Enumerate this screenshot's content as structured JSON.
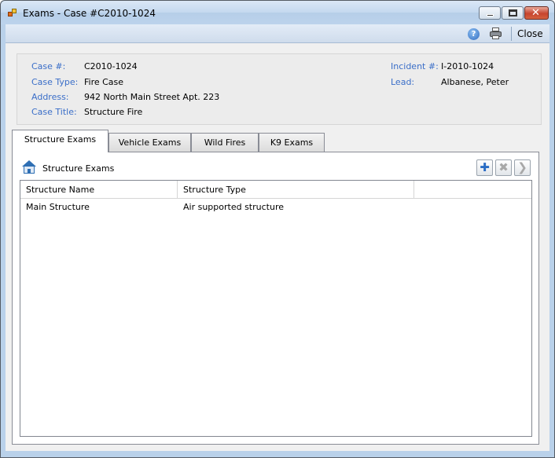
{
  "window": {
    "title": "Exams - Case #C2010-1024",
    "close_label": "Close",
    "colors": {
      "title_bar": "#c4d9ef",
      "label_blue": "#3a6ec8",
      "window_frame": "#b9d1ea"
    }
  },
  "case_info": {
    "case_number_label": "Case #:",
    "case_number": "C2010-1024",
    "case_type_label": "Case Type:",
    "case_type": "Fire Case",
    "address_label": "Address:",
    "address": "942 North Main Street Apt. 223",
    "case_title_label": "Case Title:",
    "case_title": "Structure Fire",
    "incident_label": "Incident #:",
    "incident": "I-2010-1024",
    "lead_label": "Lead:",
    "lead": "Albanese, Peter"
  },
  "tabs": [
    {
      "label": "Structure Exams",
      "active": true
    },
    {
      "label": "Vehicle Exams",
      "active": false
    },
    {
      "label": "Wild Fires",
      "active": false
    },
    {
      "label": "K9 Exams",
      "active": false
    }
  ],
  "section": {
    "title": "Structure Exams",
    "icon": "house-icon",
    "actions": [
      "add-icon",
      "delete-icon",
      "next-icon"
    ]
  },
  "grid": {
    "columns": [
      "Structure Name",
      "Structure Type",
      ""
    ],
    "rows": [
      {
        "name": "Main Structure",
        "type": "Air supported structure"
      }
    ]
  }
}
